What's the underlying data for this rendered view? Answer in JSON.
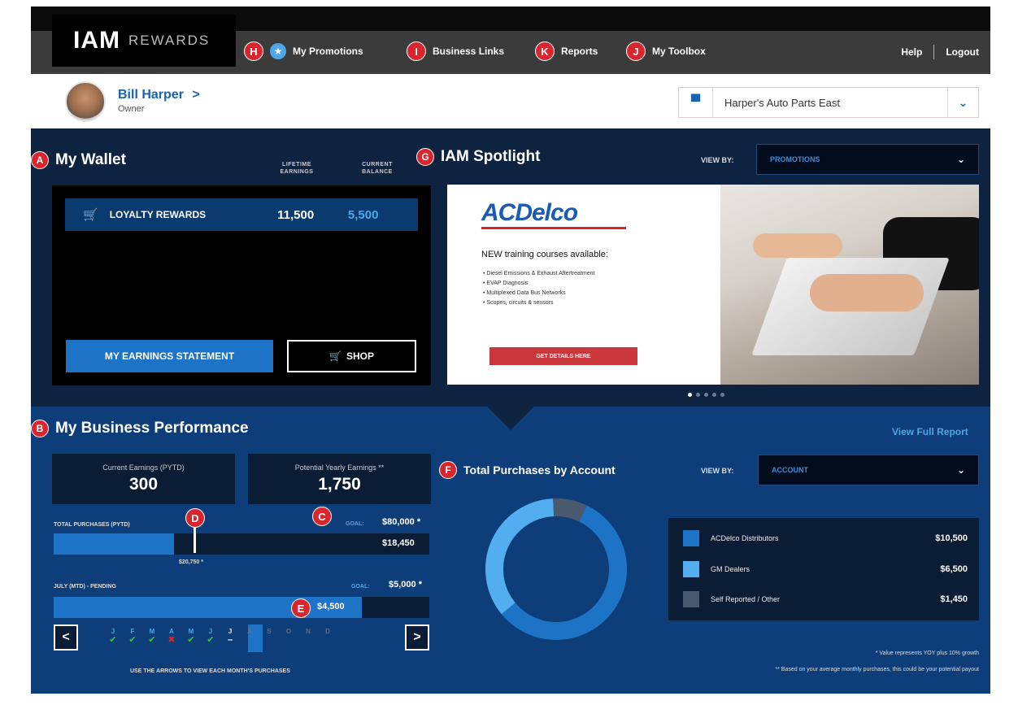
{
  "brand": {
    "bold": "IAM",
    "light": "REWARDS"
  },
  "nav": [
    {
      "badge": "H",
      "label": "My Promotions",
      "icon": "star-icon"
    },
    {
      "badge": "I",
      "label": "Business Links"
    },
    {
      "badge": "K",
      "label": "Reports"
    },
    {
      "badge": "J",
      "label": "My Toolbox"
    }
  ],
  "top_links": {
    "help": "Help",
    "logout": "Logout"
  },
  "user": {
    "name": "Bill Harper",
    "chevron": ">",
    "role": "Owner"
  },
  "store_select": {
    "value": "Harper's Auto Parts East",
    "icon": "store-icon"
  },
  "wallet": {
    "badge": "A",
    "title": "My Wallet",
    "col_lifetime": "LIFETIME EARNINGS",
    "col_balance": "CURRENT BALANCE",
    "row": {
      "label": "LOYALTY REWARDS",
      "lifetime": "11,500",
      "balance": "5,500",
      "icon": "cart-icon"
    },
    "statement_button": "MY EARNINGS STATEMENT",
    "shop_button": "SHOP"
  },
  "spotlight": {
    "badge": "G",
    "title": "IAM Spotlight",
    "view_by_label": "VIEW BY:",
    "view_by_value": "PROMOTIONS",
    "brand": "ACDelco",
    "headline": "NEW training courses available:",
    "items": [
      "Diesel Emissions & Exhaust Aftertreatment",
      "EVAP Diagnosis",
      "Multiplexed Data Bus Networks",
      "Scopes, circuits & sensors"
    ],
    "cta": "GET DETAILS HERE",
    "slides": 5,
    "active_slide": 1
  },
  "performance": {
    "badge": "B",
    "title": "My Business Performance",
    "view_full": "View Full Report",
    "kpis": [
      {
        "label": "Current Earnings (PYTD)",
        "value": "300"
      },
      {
        "label": "Potential Yearly Earnings **",
        "value": "1,750"
      }
    ],
    "total_purchases": {
      "label": "TOTAL PURCHASES (PYTD)",
      "badge_marker": "D",
      "badge_goal": "C",
      "goal_label": "GOAL:",
      "goal_value": "$80,000 *",
      "current_value": "$18,450",
      "marker_value": "$20,750 *",
      "fill_fraction": 0.32
    },
    "month": {
      "label": "JULY (MTD) - PENDING",
      "goal_label": "GOAL:",
      "goal_value": "$5,000 *",
      "badge": "E",
      "value": "$4,500",
      "fill_fraction": 0.82
    },
    "months": [
      {
        "l": "J",
        "m": "✔",
        "c": "#37c24a"
      },
      {
        "l": "F",
        "m": "✔",
        "c": "#37c24a"
      },
      {
        "l": "M",
        "m": "✔",
        "c": "#37c24a"
      },
      {
        "l": "A",
        "m": "✖",
        "c": "#d9262e"
      },
      {
        "l": "M",
        "m": "✔",
        "c": "#37c24a"
      },
      {
        "l": "J",
        "m": "✔",
        "c": "#37c24a"
      },
      {
        "l": "J",
        "m": "–",
        "c": "#ffffff"
      },
      {
        "l": "A",
        "m": "",
        "c": "#5c6f88"
      },
      {
        "l": "S",
        "m": "",
        "c": "#5c6f88"
      },
      {
        "l": "O",
        "m": "",
        "c": "#5c6f88"
      },
      {
        "l": "N",
        "m": "",
        "c": "#5c6f88"
      },
      {
        "l": "D",
        "m": "",
        "c": "#5c6f88"
      }
    ],
    "hint": "USE THE ARROWS TO VIEW EACH MONTH'S PURCHASES"
  },
  "purchases": {
    "badge": "F",
    "title": "Total Purchases by Account",
    "view_by_label": "VIEW BY:",
    "view_by_value": "ACCOUNT"
  },
  "chart_data": {
    "type": "pie",
    "categories": [
      "ACDelco Distributors",
      "GM Dealers",
      "Self Reported / Other"
    ],
    "values": [
      10500,
      6500,
      1450
    ],
    "labels": [
      "$10,500",
      "$6,500",
      "$1,450"
    ],
    "colors": [
      "#1d74c6",
      "#53aef0",
      "#4a5a6e"
    ],
    "donut": true
  },
  "footnotes": [
    "* Value represents YOY plus 10% growth",
    "** Based on your average monthly purchases, this could be your potential payout"
  ]
}
